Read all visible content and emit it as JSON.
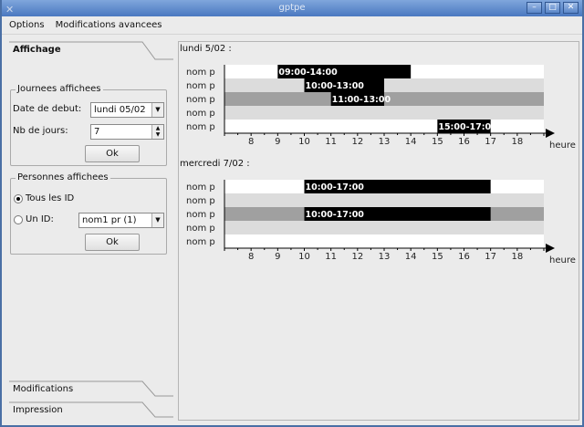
{
  "window": {
    "title": "gptpe",
    "buttons": [
      "minimize",
      "maximize",
      "close"
    ]
  },
  "menu": [
    "Options",
    "Modifications avancees"
  ],
  "sidebar": {
    "tabs": {
      "affichage": "Affichage",
      "modifications": "Modifications",
      "impression": "Impression"
    },
    "journees": {
      "title": "Journees affichees",
      "date_label": "Date de debut:",
      "date_value": "lundi 05/02",
      "nb_label": "Nb de jours:",
      "nb_value": "7",
      "ok": "Ok"
    },
    "personnes": {
      "title": "Personnes affichees",
      "tous": "Tous les ID",
      "tous_selected": true,
      "un_id": "Un ID:",
      "un_id_value": "nom1 pr (1)",
      "ok": "Ok"
    }
  },
  "colors": {
    "row_white": "#ffffff",
    "row_light": "#dcdcdc",
    "row_dark": "#a0a0a0",
    "bar": "#000000",
    "bar_text": "#ffffff"
  },
  "chart_data": [
    {
      "type": "gantt",
      "title": "lundi 5/02 :",
      "xlabel": "heure",
      "xlim": [
        7,
        19
      ],
      "ticks": [
        8,
        9,
        10,
        11,
        12,
        13,
        14,
        15,
        16,
        17,
        18
      ],
      "rows": [
        "nom p",
        "nom p",
        "nom p",
        "nom p",
        "nom p"
      ],
      "bars": [
        {
          "row": 0,
          "start": 9,
          "end": 14,
          "label": "09:00-14:00"
        },
        {
          "row": 1,
          "start": 10,
          "end": 13,
          "label": "10:00-13:00"
        },
        {
          "row": 2,
          "start": 11,
          "end": 13,
          "label": "11:00-13:00"
        },
        {
          "row": 4,
          "start": 15,
          "end": 17,
          "label": "15:00-17:00"
        }
      ]
    },
    {
      "type": "gantt",
      "title": "mercredi 7/02 :",
      "xlabel": "heure",
      "xlim": [
        7,
        19
      ],
      "ticks": [
        8,
        9,
        10,
        11,
        12,
        13,
        14,
        15,
        16,
        17,
        18
      ],
      "rows": [
        "nom p",
        "nom p",
        "nom p",
        "nom p",
        "nom p"
      ],
      "bars": [
        {
          "row": 0,
          "start": 10,
          "end": 17,
          "label": "10:00-17:00"
        },
        {
          "row": 2,
          "start": 10,
          "end": 17,
          "label": "10:00-17:00"
        }
      ]
    }
  ]
}
